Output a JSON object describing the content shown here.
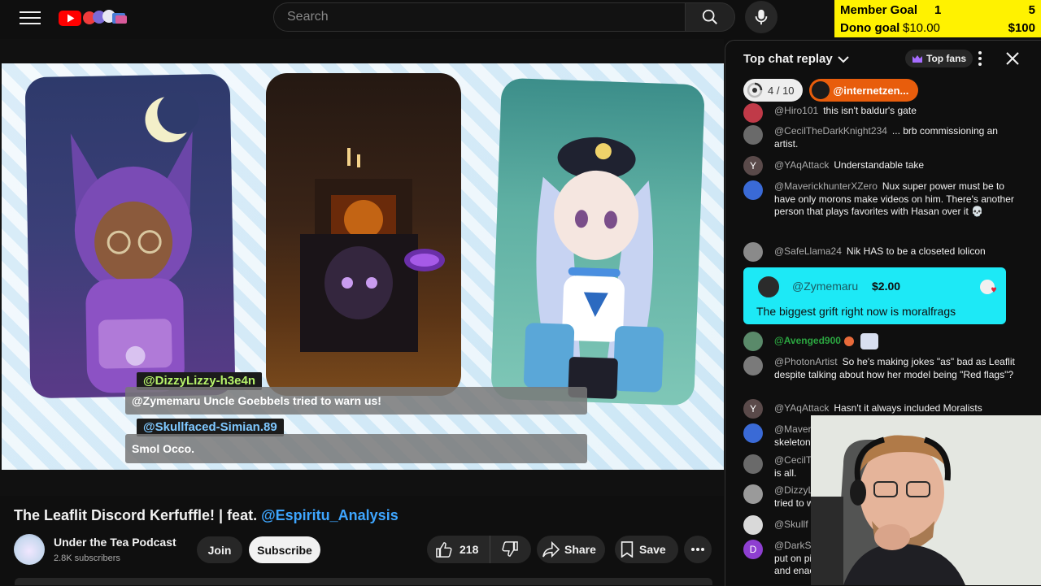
{
  "header": {
    "search_placeholder": "Search",
    "goals": [
      {
        "label": "Member Goal",
        "current": "1",
        "target": "5"
      },
      {
        "label": "Dono goal",
        "current": "$10.00",
        "target": "$100"
      }
    ]
  },
  "video": {
    "captions": [
      {
        "name": "@DizzyLizzy-h3e4n",
        "text": "@Zymemaru Uncle Goebbels tried to warn us!"
      },
      {
        "name": "@Skullfaced-Simian.89",
        "text": "Smol Occo."
      }
    ]
  },
  "meta": {
    "title": "The Leaflit Discord Kerfuffle! | feat.",
    "title_guest": "@Espiritu_Analysis",
    "channel_name": "Under the Tea Podcast",
    "subscribers": "2.8K subscribers",
    "join_label": "Join",
    "subscribe_label": "Subscribe",
    "likes": "218",
    "share_label": "Share",
    "save_label": "Save"
  },
  "chat": {
    "header": "Top chat replay",
    "top_fans_label": "Top fans",
    "ticket_count": "4 / 10",
    "ticket_user": "@internetzen...",
    "messages": [
      {
        "author": "@Hiro101",
        "text": "this isn't baldur's gate",
        "avatar_color": "#c03a48"
      },
      {
        "author": "@CecilTheDarkKnight234",
        "text": "... brb commissioning an artist.",
        "avatar_color": "#6a6a6a"
      },
      {
        "author": "@YAqAttack",
        "text": "Understandable take",
        "avatar_color": "#5a4a4a",
        "avatar_letter": "Y"
      },
      {
        "author": "@MaverickhunterXZero",
        "text": "Nux super power must be to have only morons make videos on him. There's another person that plays favorites with Hasan over it 💀",
        "avatar_color": "#3a6ad6"
      },
      {
        "author": "@SafeLlama24",
        "text": "Nik HAS to be a closeted lolicon",
        "avatar_color": "#8a8a8a"
      },
      {
        "author": "@Avenged900",
        "text": "",
        "avatar_color": "#5a8a6a",
        "member": true
      },
      {
        "author": "@PhotonArtist",
        "text": "So he's making jokes \"as\" bad as Leaflit despite talking about how her model being \"Red flags\"?",
        "avatar_color": "#7a7a7a"
      },
      {
        "author": "@YAqAttack",
        "text": "Hasn't it always included Moralists",
        "avatar_color": "#5a4a4a",
        "avatar_letter": "Y"
      },
      {
        "author": "@Maveri",
        "text": "skeleton",
        "avatar_color": "#3a6ad6"
      },
      {
        "author": "@CecilT",
        "text": "is all.",
        "avatar_color": "#6a6a6a"
      },
      {
        "author": "@DizzyL",
        "text": "tried to w",
        "avatar_color": "#9a9a9a"
      },
      {
        "author": "@Skullf",
        "text": "",
        "avatar_color": "#d9d9d9"
      },
      {
        "author": "@DarkSc",
        "text": "put on pi and enac",
        "avatar_color": "#8e3fd1",
        "avatar_letter": "D"
      }
    ],
    "superchat": {
      "author": "@Zymemaru",
      "amount": "$2.00",
      "text": "The biggest grift right now is moralfrags"
    }
  }
}
